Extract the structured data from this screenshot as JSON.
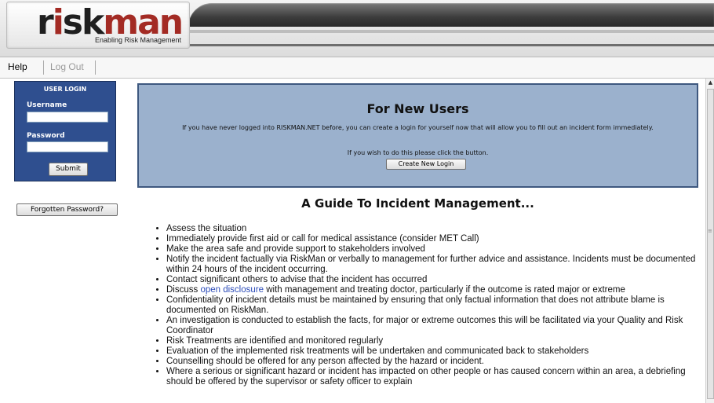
{
  "header": {
    "logo_part1": "r",
    "logo_i": "i",
    "logo_part2": "sk",
    "logo_part3": "man",
    "tagline": "Enabling Risk Management"
  },
  "nav": {
    "help": "Help",
    "logout": "Log Out"
  },
  "login": {
    "title": "USER LOGIN",
    "username_label": "Username",
    "username_value": "",
    "password_label": "Password",
    "password_value": "",
    "submit": "Submit",
    "forgot": "Forgotten Password?"
  },
  "new_users": {
    "title": "For New Users",
    "text1": "If you have never logged into RISKMAN.NET before, you can create a login for yourself now that will allow you to fill out an incident form immediately.",
    "text2": "If you wish to do this please click the button.",
    "button": "Create New Login"
  },
  "guide": {
    "title": "A Guide To Incident Management...",
    "items": [
      "Assess the situation",
      "Immediately provide first aid or call for medical assistance (consider MET Call)",
      "Make the area safe and provide support to stakeholders involved",
      "Notify the incident factually via RiskMan or verbally to management for further advice and assistance. Incidents must be documented within 24 hours of the incident occurring.",
      "Contact significant others to advise that the incident has occurred",
      "Confidentiality of incident details must be maintained by ensuring that only factual information that does not attribute blame is documented on RiskMan.",
      "An investigation is conducted to establish the facts, for major or extreme outcomes this will be facilitated via your Quality and Risk Coordinator",
      "Risk Treatments are identified and monitored regularly",
      "Evaluation of the implemented risk treatments will be undertaken and communicated back to stakeholders",
      "Counselling should be offered for any person affected by the hazard or incident.",
      "Where a serious or significant hazard or incident has impacted on other people or has caused concern within an area, a debriefing should be offered by the supervisor or safety officer to explain"
    ],
    "disclosure_prefix": "Discuss ",
    "disclosure_link": "open disclosure",
    "disclosure_suffix": " with management and treating doctor, particularly if the outcome is rated major or extreme"
  },
  "colors": {
    "login_bg": "#2f4f8f",
    "new_users_bg": "#9bb1cd",
    "link": "#2b4bb8",
    "logo_red": "#a32b24"
  }
}
